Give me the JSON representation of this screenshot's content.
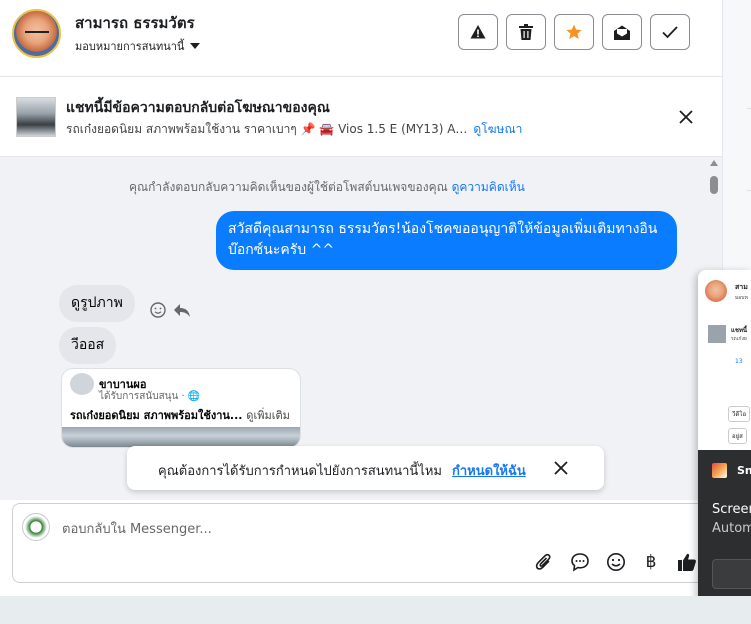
{
  "header": {
    "name": "สามารถ ธรรมวัตร",
    "subtitle": "มอบหมายการสนทนานี้",
    "actions": [
      "report-icon",
      "delete-icon",
      "star-icon",
      "mark-unread-icon",
      "done-icon"
    ],
    "star_color": "#f7931e"
  },
  "ad_banner": {
    "title": "แชทนี้มีข้อความตอบกลับต่อโฆษณาของคุณ",
    "description": "รถเก๋งยอดนิยม สภาพพร้อมใช้งาน ราคาเบาๆ 📌 🚘 Vios 1.5 E (MY13) A…",
    "link": "ดูโฆษณา"
  },
  "chat": {
    "system_message": "คุณกำลังตอบกลับความคิดเห็นของผู้ใช้ต่อโพสต์บนเพจของคุณ",
    "system_link": "ดูความคิดเห็น",
    "outgoing": "สวัสดีคุณสามารถ ธรรมวัตร!น้องโชคขออนุญาติให้ข้อมูลเพิ่มเติมทางอินบ๊อกซ์นะครับ ^^",
    "incoming": [
      "ดูรูปภาพ",
      "วีออส"
    ],
    "shared_post": {
      "page_name": "ขาบานผอ",
      "sponsored": "ได้รับการสนับสนุน · 🌐",
      "text": "รถเก๋งยอดนิยม สภาพพร้อมใช้งาน...",
      "more": "ดูเพิ่มเติม"
    }
  },
  "toast": {
    "text": "คุณต้องการได้รับการกำหนดไปยังการสนทนานี้ไหม",
    "link": "กำหนดให้ฉัน"
  },
  "composer": {
    "placeholder": "ตอบกลับใน Messenger...",
    "tools": [
      "attach-icon",
      "saved-reply-icon",
      "emoji-icon",
      "payment-icon",
      "like-icon"
    ],
    "currency_glyph": "฿"
  },
  "mini_window": {
    "name": "สาม",
    "sub": "มอบห",
    "ad": "แชทนี้",
    "ad_sub": "รถเก๋งย",
    "count": "13",
    "btn1": "วีดีโอ",
    "btn2": "อยู่ส",
    "notif_title": "Sn",
    "notif_line1": "Screen",
    "notif_line2": "Autom"
  }
}
